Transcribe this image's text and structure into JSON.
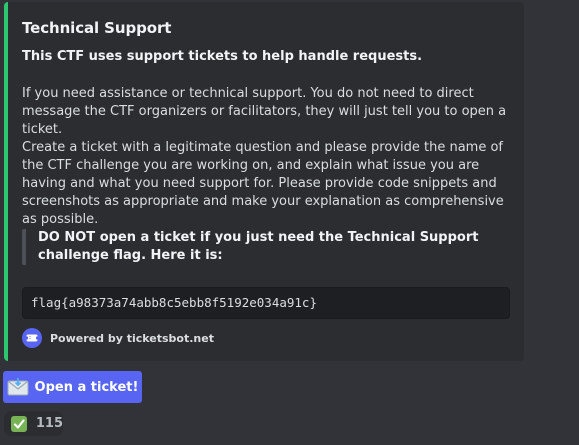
{
  "embed": {
    "title": "Technical Support",
    "bold_line": "This CTF uses support tickets to help handle requests.",
    "paragraph_1": "If you need assistance or technical support. You do not need to direct message the CTF organizers or facilitators, they will just tell you to open a ticket.",
    "paragraph_2": "Create a ticket with a legitimate question and please provide the name of the CTF challenge you are working on, and explain what issue you are having and what you need support for. Please provide code snippets and screenshots as appropriate and make your explanation as comprehensive as possible.",
    "quote": "DO NOT open a ticket if you just need the Technical Support challenge flag. Here it is:",
    "code": "flag{a98373a74abb8c5ebb8f5192e034a91c}",
    "footer_text": "Powered by ticketsbot.net",
    "accent_color": "#2dc770"
  },
  "button": {
    "label": "Open a ticket!",
    "icon": "envelope-icon",
    "color": "#5865f2"
  },
  "reaction": {
    "emoji": "check-mark-icon",
    "count": "115"
  }
}
